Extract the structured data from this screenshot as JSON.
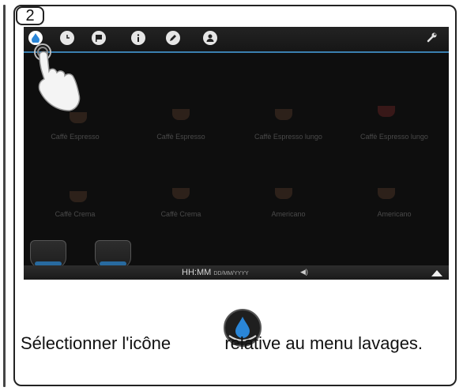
{
  "step": {
    "number": "2"
  },
  "screen": {
    "topbar": {
      "icons": [
        "water-drop-icon",
        "clock-icon",
        "flag-icon",
        "info-icon",
        "pencil-icon",
        "user-icon"
      ],
      "wrench": "wrench-icon",
      "accent_color": "#3a7fb0"
    },
    "beverages": [
      "Caffè Espresso",
      "Caffè Espresso",
      "Caffè Espresso lungo",
      "Caffè Espresso lungo",
      "Caffè Crema",
      "Caffè Crema",
      "Americano",
      "Americano"
    ],
    "bottombar": {
      "time": "HH:MM",
      "date": "DD/MM/YYYY"
    }
  },
  "caption": {
    "before": "Sélectionner l'icône",
    "after": "relative au menu lavages."
  }
}
